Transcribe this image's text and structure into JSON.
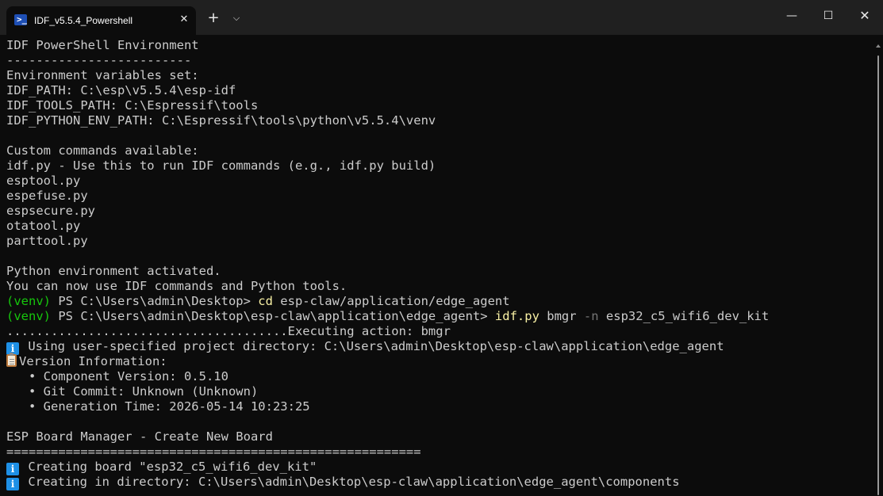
{
  "window": {
    "tab_title": "IDF_v5.5.4_Powershell",
    "tab_close": "✕",
    "new_tab": "+",
    "tab_dropdown": "⌵",
    "minimize": "—",
    "maximize": "☐",
    "close": "✕"
  },
  "icons": {
    "tab": "powershell-icon",
    "info": "info-icon",
    "clipboard": "clipboard-icon"
  },
  "colors": {
    "background": "#0c0c0c",
    "titlebar": "#202020",
    "text": "#cccccc",
    "prompt_venv": "#16c60c",
    "command": "#f9f1a5",
    "parameter": "#767676",
    "info_icon": "#1e90e6"
  },
  "terminal": {
    "header_title": "IDF PowerShell Environment",
    "header_rule": "-------------------------",
    "env_heading": "Environment variables set:",
    "env_vars": [
      "IDF_PATH: C:\\esp\\v5.5.4\\esp-idf",
      "IDF_TOOLS_PATH: C:\\Espressif\\tools",
      "IDF_PYTHON_ENV_PATH: C:\\Espressif\\tools\\python\\v5.5.4\\venv"
    ],
    "custom_heading": "Custom commands available:",
    "custom_commands": [
      "idf.py - Use this to run IDF commands (e.g., idf.py build)",
      "esptool.py",
      "espefuse.py",
      "espsecure.py",
      "otatool.py",
      "parttool.py"
    ],
    "python_activated": "Python environment activated.",
    "python_hint": "You can now use IDF commands and Python tools.",
    "prompt1": {
      "venv": "(venv)",
      "path": " PS C:\\Users\\admin\\Desktop> ",
      "command": "cd",
      "args": " esp-claw/application/edge_agent"
    },
    "prompt2": {
      "venv": "(venv)",
      "path": " PS C:\\Users\\admin\\Desktop\\esp-claw\\application\\edge_agent> ",
      "command": "idf.py",
      "arg1": " bmgr ",
      "param": "-n",
      "arg2": " esp32_c5_wifi6_dev_kit"
    },
    "executing": "......................................Executing action: bmgr",
    "project_dir": " Using user-specified project directory: C:\\Users\\admin\\Desktop\\esp-claw\\application\\edge_agent",
    "version_heading": "Version Information:",
    "version_items": [
      "   • Component Version: 0.5.10",
      "   • Git Commit: Unknown (Unknown)",
      "   • Generation Time: 2026-05-14 10:23:25"
    ],
    "board_manager_title": "ESP Board Manager - Create New Board",
    "board_manager_rule": "========================================================",
    "creating_board": " Creating board \"esp32_c5_wifi6_dev_kit\"",
    "creating_dir": " Creating in directory: C:\\Users\\admin\\Desktop\\esp-claw\\application\\edge_agent\\components"
  }
}
